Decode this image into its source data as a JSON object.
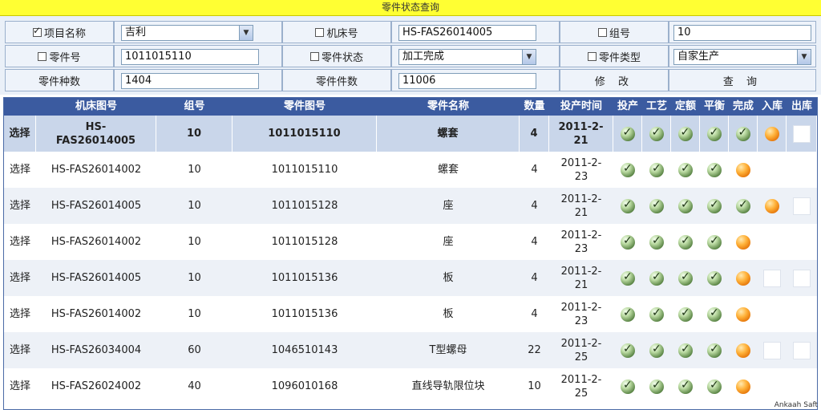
{
  "title": "零件状态查询",
  "filters": {
    "row1": {
      "project_label": "项目名称",
      "project_checked": true,
      "project_value": "吉利",
      "machine_label": "机床号",
      "machine_value": "HS-FAS26014005",
      "group_label": "组号",
      "group_value": "10"
    },
    "row2": {
      "part_no_label": "零件号",
      "part_no_value": "1011015110",
      "status_label": "零件状态",
      "status_value": "加工完成",
      "type_label": "零件类型",
      "type_value": "自家生产"
    },
    "row3": {
      "kinds_label": "零件种数",
      "kinds_value": "1404",
      "count_label": "零件件数",
      "count_value": "11006",
      "modify_label": "修 改",
      "query_label": "查 询"
    }
  },
  "table": {
    "headers": [
      "",
      "机床图号",
      "组号",
      "零件图号",
      "零件名称",
      "数量",
      "投产时间",
      "投产",
      "工艺",
      "定额",
      "平衡",
      "完成",
      "入库",
      "出库"
    ],
    "rows": [
      {
        "select": "选择",
        "machine": "HS-\nFAS26014005",
        "group": "10",
        "part": "1011015110",
        "name": "螺套",
        "qty": "4",
        "date": "2011-2-\n21",
        "status": [
          "ok",
          "ok",
          "ok",
          "ok",
          "ok",
          "orange",
          "box"
        ]
      },
      {
        "select": "选择",
        "machine": "HS-FAS26014002",
        "group": "10",
        "part": "1011015110",
        "name": "螺套",
        "qty": "4",
        "date": "2011-2-\n23",
        "status": [
          "ok",
          "ok",
          "ok",
          "ok",
          "orange",
          "",
          ""
        ]
      },
      {
        "select": "选择",
        "machine": "HS-FAS26014005",
        "group": "10",
        "part": "1011015128",
        "name": "座",
        "qty": "4",
        "date": "2011-2-\n21",
        "status": [
          "ok",
          "ok",
          "ok",
          "ok",
          "ok",
          "orange",
          "box"
        ]
      },
      {
        "select": "选择",
        "machine": "HS-FAS26014002",
        "group": "10",
        "part": "1011015128",
        "name": "座",
        "qty": "4",
        "date": "2011-2-\n23",
        "status": [
          "ok",
          "ok",
          "ok",
          "ok",
          "orange",
          "",
          ""
        ]
      },
      {
        "select": "选择",
        "machine": "HS-FAS26014005",
        "group": "10",
        "part": "1011015136",
        "name": "板",
        "qty": "4",
        "date": "2011-2-\n21",
        "status": [
          "ok",
          "ok",
          "ok",
          "ok",
          "orange",
          "box",
          "box"
        ]
      },
      {
        "select": "选择",
        "machine": "HS-FAS26014002",
        "group": "10",
        "part": "1011015136",
        "name": "板",
        "qty": "4",
        "date": "2011-2-\n23",
        "status": [
          "ok",
          "ok",
          "ok",
          "ok",
          "orange",
          "",
          ""
        ]
      },
      {
        "select": "选择",
        "machine": "HS-FAS26034004",
        "group": "60",
        "part": "1046510143",
        "name": "T型螺母",
        "qty": "22",
        "date": "2011-2-\n25",
        "status": [
          "ok",
          "ok",
          "ok",
          "ok",
          "orange",
          "box",
          "box"
        ]
      },
      {
        "select": "选择",
        "machine": "HS-FAS26024002",
        "group": "40",
        "part": "1096010168",
        "name": "直线导轨限位块",
        "qty": "10",
        "date": "2011-2-\n25",
        "status": [
          "ok",
          "ok",
          "ok",
          "ok",
          "orange",
          "",
          ""
        ]
      }
    ]
  },
  "watermark": "Ankaah Saft"
}
